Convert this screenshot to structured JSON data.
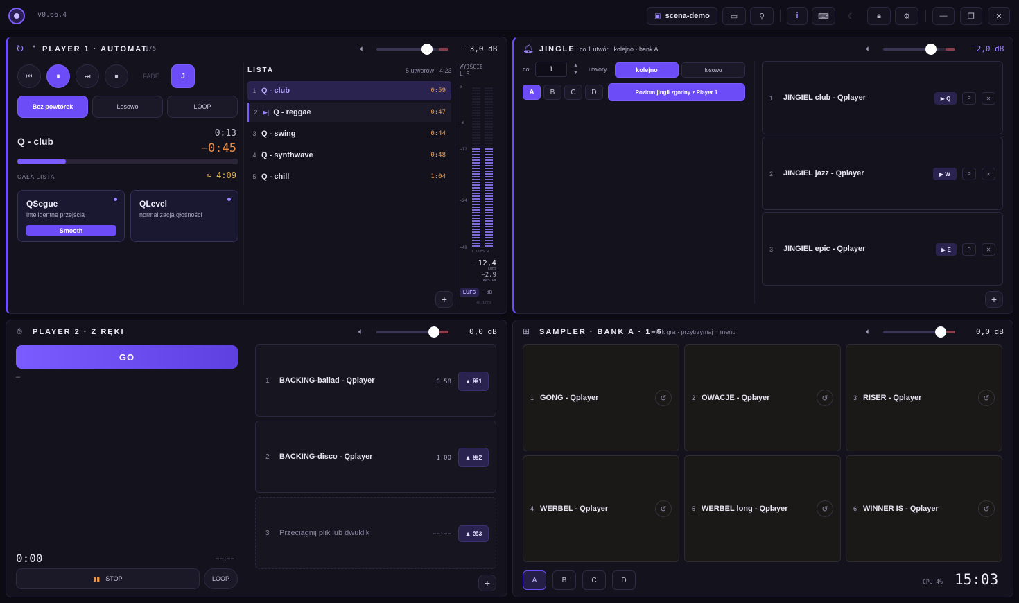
{
  "app": {
    "version": "v0.66.4",
    "scene": "scena-demo",
    "info": "i"
  },
  "player1": {
    "title": "PLAYER 1 · AUTOMAT",
    "count": "1/5",
    "db": "−3,0 dB",
    "volume": 0.82,
    "fade": "FADE",
    "j": "J",
    "modes": [
      "Bez powtórek",
      "Losowo",
      "LOOP"
    ],
    "track": "Q - club",
    "elapsed": "0:13",
    "remaining": "−0:45",
    "progress": 0.22,
    "whole_list_label": "CAŁA LISTA",
    "whole_list_time": "≈ 4:09",
    "qsegue": {
      "title": "QSegue",
      "desc": "inteligentne przejścia",
      "badge": "Smooth"
    },
    "qlevel": {
      "title": "QLevel",
      "desc": "normalizacja głośności"
    },
    "list": {
      "title": "LISTA",
      "info": "5 utworów · 4:23",
      "items": [
        {
          "n": "1",
          "title": "Q - club",
          "dur": "0:59"
        },
        {
          "n": "2",
          "title": "Q - reggae",
          "dur": "0:47"
        },
        {
          "n": "3",
          "title": "Q - swing",
          "dur": "0:44"
        },
        {
          "n": "4",
          "title": "Q - synthwave",
          "dur": "0:48"
        },
        {
          "n": "5",
          "title": "Q - chill",
          "dur": "1:04"
        }
      ]
    },
    "output": {
      "title": "WYJŚCIE",
      "lr": "L R",
      "scale": [
        "0",
        "−6",
        "−12",
        "−24",
        "−48"
      ],
      "foot": "L LUFS R",
      "lufs": "−12,4",
      "lufs_unit": "LUFS",
      "peak": "−2,9",
      "peak_unit": "DBFS PK",
      "mode_lufs": "LUFS",
      "mode_db": "dB",
      "sr": "48.1770"
    }
  },
  "jingle": {
    "title": "JINGLE",
    "sub": "co 1 utwór · kolejno · bank A",
    "db": "−2,0 dB",
    "volume": 0.78,
    "every_label": "co",
    "every_value": "1",
    "tracks_label": "utwory",
    "order": [
      "kolejno",
      "losowo"
    ],
    "banks": [
      "A",
      "B",
      "C",
      "D"
    ],
    "level_btn": "Poziom jingli zgodny z Player 1",
    "items": [
      {
        "n": "1",
        "title": "JINGIEL club - Qplayer",
        "key": "▶ Q",
        "p": "P",
        "x": "✕"
      },
      {
        "n": "2",
        "title": "JINGIEL jazz - Qplayer",
        "key": "▶ W",
        "p": "P",
        "x": "✕"
      },
      {
        "n": "3",
        "title": "JINGIEL epic - Qplayer",
        "key": "▶ E",
        "p": "P",
        "x": "✕"
      }
    ]
  },
  "player2": {
    "title": "PLAYER 2 · Z RĘKI",
    "db": "0,0 dB",
    "volume": 0.8,
    "go": "GO",
    "dash": "–",
    "time": "0:00",
    "remaining": "−−:−−",
    "stop": "STOP",
    "loop": "LOOP",
    "items": [
      {
        "n": "1",
        "title": "BACKING-ballad - Qplayer",
        "dur": "0:58",
        "key": "▲ ⌘1"
      },
      {
        "n": "2",
        "title": "BACKING-disco - Qplayer",
        "dur": "1:00",
        "key": "▲ ⌘2"
      },
      {
        "n": "3",
        "title": "Przeciągnij plik lub dwuklik",
        "dur": "−−:−−",
        "key": "▲ ⌘3"
      }
    ]
  },
  "sampler": {
    "title": "SAMPLER · BANK A · 1–6",
    "sub": "klik gra · przytrzymaj = menu",
    "db": "0,0 dB",
    "volume": 0.8,
    "pads": [
      {
        "n": "1",
        "title": "GONG - Qplayer"
      },
      {
        "n": "2",
        "title": "OWACJE - Qplayer"
      },
      {
        "n": "3",
        "title": "RISER - Qplayer"
      },
      {
        "n": "4",
        "title": "WERBEL - Qplayer"
      },
      {
        "n": "5",
        "title": "WERBEL long - Qplayer"
      },
      {
        "n": "6",
        "title": "WINNER IS - Qplayer"
      }
    ],
    "banks": [
      "A",
      "B",
      "C",
      "D"
    ],
    "cpu": "CPU 4%",
    "clock": "15:03"
  }
}
